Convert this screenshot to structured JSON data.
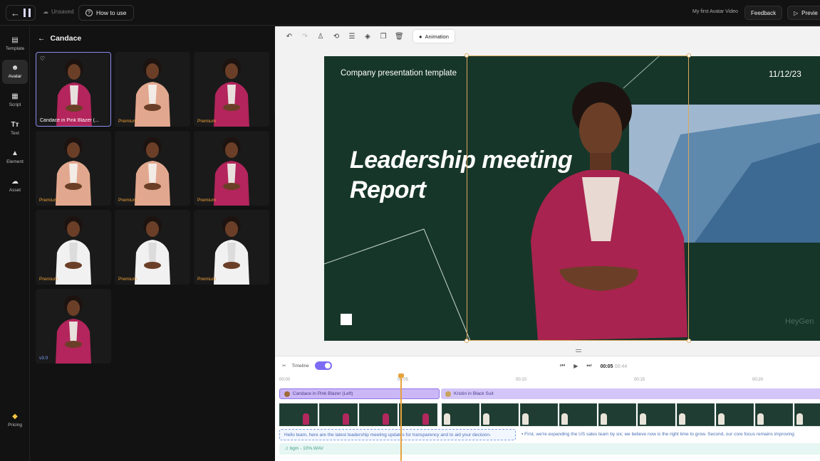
{
  "topbar": {
    "unsaved": "Unsaved",
    "how_to_use": "How to use",
    "project_name": "My first Avatar Video",
    "feedback": "Feedback",
    "preview": "Previe"
  },
  "nav": {
    "items": [
      {
        "label": "Template",
        "icon": "template-icon"
      },
      {
        "label": "Avatar",
        "icon": "avatar-icon"
      },
      {
        "label": "Script",
        "icon": "script-icon"
      },
      {
        "label": "Text",
        "icon": "text-icon"
      },
      {
        "label": "Element",
        "icon": "element-icon"
      },
      {
        "label": "Asset",
        "icon": "asset-icon"
      }
    ],
    "pricing": "Pricing"
  },
  "panel": {
    "title": "Candace",
    "tiles": [
      {
        "label": "Candace in Pink Blazer (...",
        "badge": "",
        "outfit": "#b3255c",
        "inner": "#e8e0dc"
      },
      {
        "label": "",
        "badge": "Premium",
        "outfit": "#e2a88f",
        "inner": "#f3ece6"
      },
      {
        "label": "",
        "badge": "Premium",
        "outfit": "#b3255c",
        "inner": "#e8e0dc"
      },
      {
        "label": "",
        "badge": "Premium",
        "outfit": "#e2a88f",
        "inner": "#f3ece6"
      },
      {
        "label": "",
        "badge": "Premium",
        "outfit": "#e2a88f",
        "inner": "#f3ece6"
      },
      {
        "label": "",
        "badge": "Premium",
        "outfit": "#b3255c",
        "inner": "#e8e0dc"
      },
      {
        "label": "",
        "badge": "Premium",
        "outfit": "#f1f1f1",
        "inner": "#dcdcdc"
      },
      {
        "label": "",
        "badge": "Premium",
        "outfit": "#f1f1f1",
        "inner": "#dcdcdc"
      },
      {
        "label": "",
        "badge": "Premium",
        "outfit": "#f1f1f1",
        "inner": "#dcdcdc"
      },
      {
        "label": "",
        "badge": "v3.0",
        "outfit": "#b3255c",
        "inner": "#e8e0dc"
      }
    ]
  },
  "toolbar": {
    "animation": "Animation"
  },
  "slide": {
    "template_title": "Company presentation template",
    "date": "11/12/23",
    "title_line1": "Leadership meeting",
    "title_line2": "Report",
    "watermark": "HeyGen",
    "bg_color": "#17362a"
  },
  "timeline": {
    "label": "Timeline",
    "current_time": "00:05",
    "total_time": "00:44",
    "ruler": [
      "00:00",
      "00:05",
      "00:10",
      "00:15",
      "00:20"
    ],
    "avatar_track_1": "Candace in Pink Blazer (Left)",
    "avatar_track_2": "Kristin in Black Suit",
    "script_1": "Hello team, here are the latest leadership meeting updates for transparency and to aid your decision-",
    "script_2": "First, we're expanding the US sales team by six; we believe now is the right time to grow. Second, our core focus remains improving",
    "audio": "bgm - 10%.WAV"
  }
}
